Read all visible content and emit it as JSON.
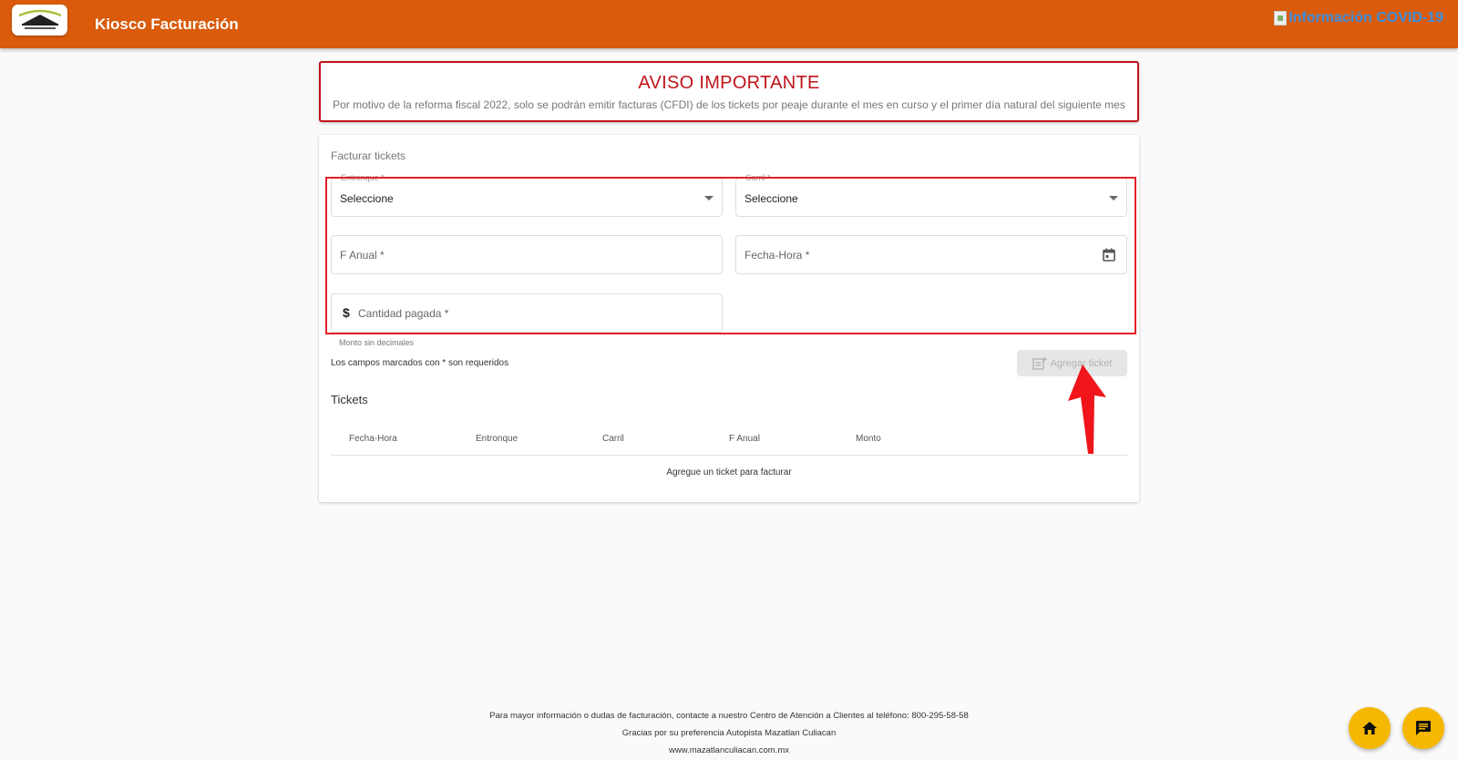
{
  "header": {
    "app_title": "Kiosco Facturación",
    "covid_link": "Información COVID-19"
  },
  "notice": {
    "title": "AVISO IMPORTANTE",
    "text": "Por motivo de la reforma fiscal 2022, solo se podrán emitir facturas (CFDI) de los tickets por peaje durante el mes en curso y el primer día natural del siguiente mes"
  },
  "form": {
    "title": "Facturar tickets",
    "entronque": {
      "label": "Entronque *",
      "value": "Seleccione"
    },
    "carril": {
      "label": "Carril *",
      "value": "Seleccione"
    },
    "f_anual": {
      "placeholder": "F Anual *"
    },
    "fecha_hora": {
      "placeholder": "Fecha-Hora *"
    },
    "cantidad": {
      "placeholder": "Cantidad pagada *",
      "prefix": "$",
      "hint": "Monto sin decimales"
    },
    "required_note": "Los campos marcados con * son requeridos",
    "add_button": "Agregar ticket"
  },
  "tickets": {
    "title": "Tickets",
    "columns": [
      "Fecha-Hora",
      "Entronque",
      "Carril",
      "F Anual",
      "Monto"
    ],
    "empty_message": "Agregue un ticket para facturar"
  },
  "footer": {
    "line1": "Para mayor información o dudas de facturación, contacte a nuestro Centro de Atención a Clientes al teléfono: 800-295-58-58",
    "line2": "Gracias por su preferencia Autopista Mazatlan Culiacan",
    "line3": "www.mazatlanculiacan.com.mx"
  },
  "colors": {
    "header_bg": "#d95b0b",
    "notice_red": "#c0141b",
    "fab_yellow": "#f5b700"
  }
}
